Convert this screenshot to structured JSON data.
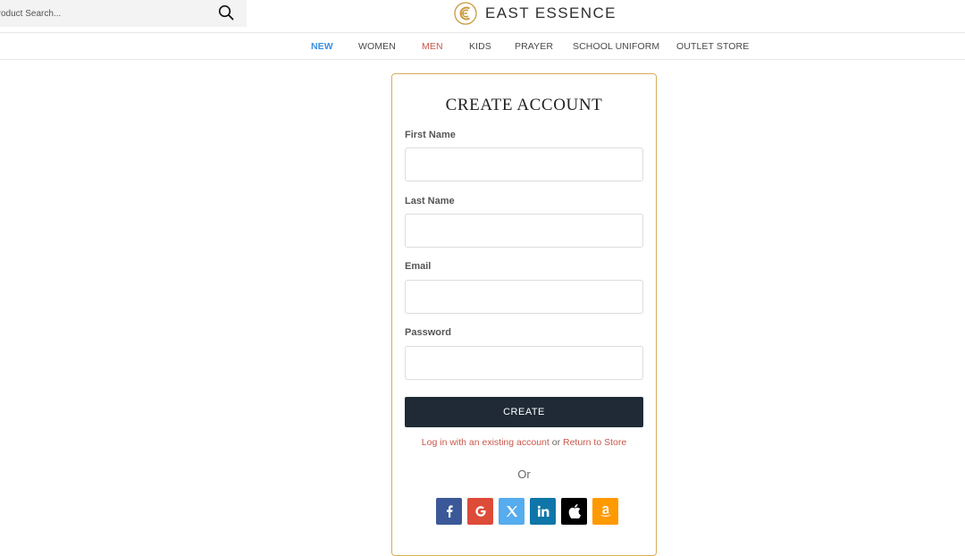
{
  "header": {
    "search_placeholder": "Product Search...",
    "logo_text": "EAST ESSENCE"
  },
  "nav": {
    "items": [
      {
        "label": "NEW"
      },
      {
        "label": "WOMEN"
      },
      {
        "label": "MEN"
      },
      {
        "label": "KIDS"
      },
      {
        "label": "PRAYER"
      },
      {
        "label": "SCHOOL UNIFORM"
      },
      {
        "label": "OUTLET STORE"
      }
    ]
  },
  "form": {
    "title": "CREATE ACCOUNT",
    "first_name_label": "First Name",
    "last_name_label": "Last Name",
    "email_label": "Email",
    "password_label": "Password",
    "first_name_value": "",
    "last_name_value": "",
    "email_value": "",
    "password_value": "",
    "create_label": "CREATE",
    "login_link": "Log in with an existing account",
    "or_inline": "or",
    "return_link": "Return to Store",
    "or_separator": "Or"
  },
  "social": [
    {
      "icon": "facebook-icon",
      "color": "#3b5998"
    },
    {
      "icon": "google-icon",
      "color": "#dd4b39"
    },
    {
      "icon": "x-icon",
      "color": "#55acee"
    },
    {
      "icon": "linkedin-icon",
      "color": "#0e76a8"
    },
    {
      "icon": "apple-icon",
      "color": "#000000"
    },
    {
      "icon": "amazon-icon",
      "color": "#ff9900"
    }
  ],
  "colors": {
    "accent_gold": "#d9ad55",
    "nav_new": "#3a8ee0",
    "nav_men": "#c4564b",
    "link": "#c9574a",
    "button_dark": "#1f2a36"
  }
}
